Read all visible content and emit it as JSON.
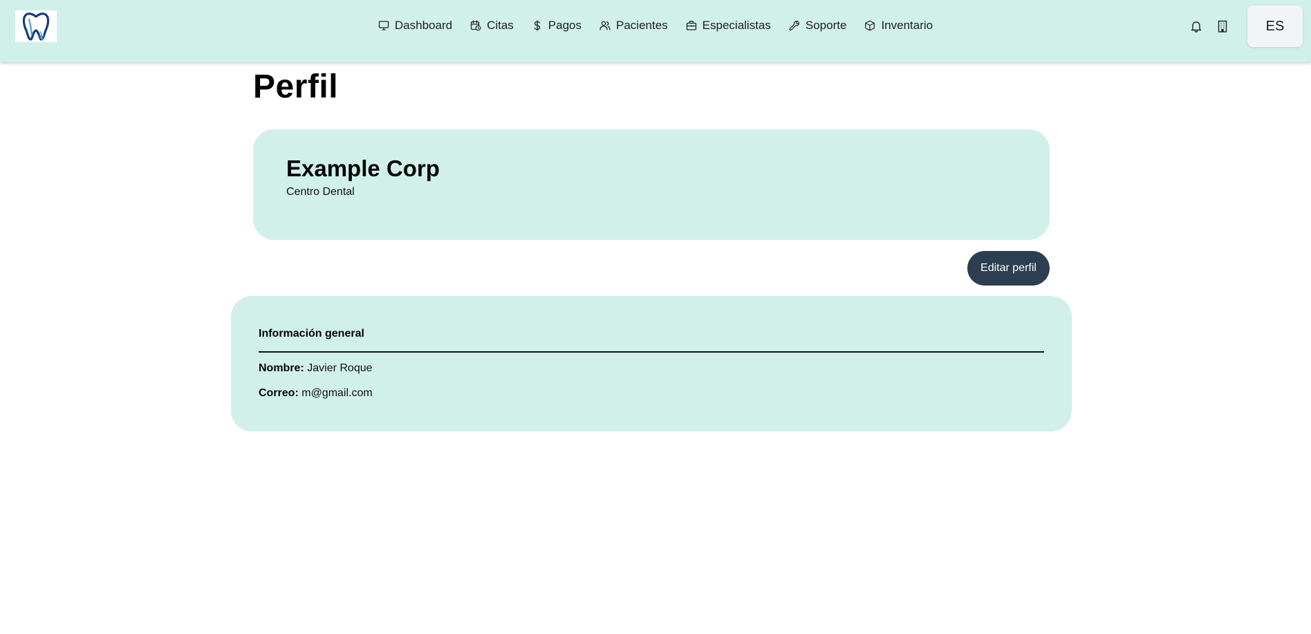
{
  "header": {
    "logo_name": "tooth-logo",
    "nav": [
      {
        "label": "Dashboard",
        "icon": "monitor-icon"
      },
      {
        "label": "Citas",
        "icon": "calendar-clock-icon"
      },
      {
        "label": "Pagos",
        "icon": "dollar-icon"
      },
      {
        "label": "Pacientes",
        "icon": "users-icon"
      },
      {
        "label": "Especialistas",
        "icon": "briefcase-icon"
      },
      {
        "label": "Soporte",
        "icon": "wrench-icon"
      },
      {
        "label": "Inventario",
        "icon": "box-icon"
      }
    ],
    "tools": {
      "notifications_icon": "bell-icon",
      "building_icon": "building-icon",
      "language": "ES"
    }
  },
  "page": {
    "title": "Perfil"
  },
  "company": {
    "name": "Example Corp",
    "type": "Centro Dental"
  },
  "actions": {
    "edit_label": "Editar perfil"
  },
  "info": {
    "title": "Información general",
    "name_label": "Nombre:",
    "name_value": "Javier Roque",
    "email_label": "Correo:",
    "email_value": "m@gmail.com"
  },
  "colors": {
    "header_bg": "#d1f0e9",
    "card_bg": "#d1f0e9",
    "button_bg": "#2c3e50",
    "lang_bg": "#f3f4f6"
  }
}
